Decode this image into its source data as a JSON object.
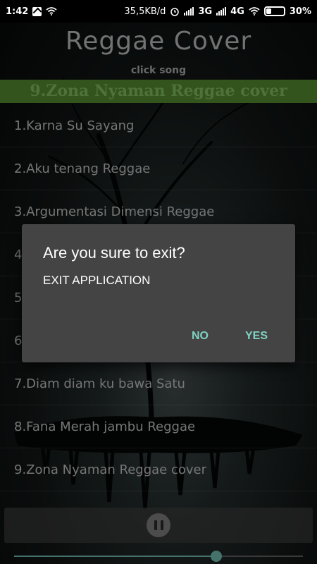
{
  "status_bar": {
    "time": "1:42",
    "network_speed": "35,5KB/d",
    "network_type_1": "3G",
    "network_type_2": "4G",
    "battery": "30%",
    "battery_level": 0.3,
    "icons": [
      "upload-notification-icon",
      "wifi-icon",
      "alarm-icon",
      "signal-icon",
      "battery-icon"
    ]
  },
  "header": {
    "app_title": "Reggae Cover",
    "subtitle": "click song",
    "now_playing": "9.Zona Nyaman Reggae cover"
  },
  "songs": [
    "1.Karna Su Sayang",
    "2.Aku tenang Reggae",
    "3.Argumentasi Dimensi Reggae",
    "4",
    "5",
    "6",
    "7.Diam diam ku bawa Satu",
    "8.Fana Merah jambu Reggae",
    "9.Zona Nyaman Reggae cover"
  ],
  "player": {
    "control_icon": "pause-icon",
    "progress": 0.7
  },
  "dialog": {
    "title": "Are you sure to exit?",
    "message": "EXIT APPLICATION",
    "no_label": "NO",
    "yes_label": "YES"
  },
  "colors": {
    "accent": "#7fd2c3",
    "now_playing_bg": "#5d9a35",
    "now_playing_text": "#8fd06a",
    "dialog_bg": "#444444"
  }
}
